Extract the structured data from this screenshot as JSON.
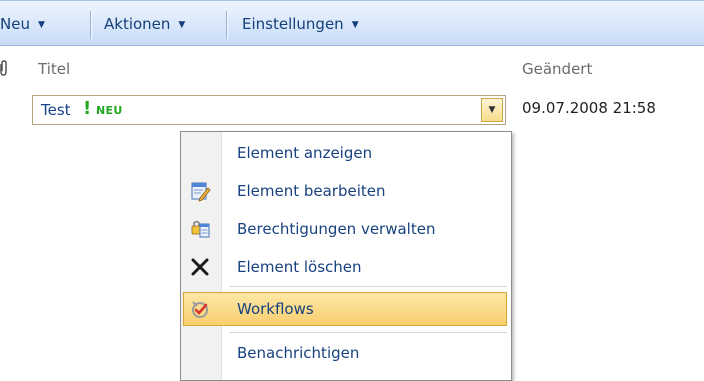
{
  "toolbar": {
    "new_label": "Neu",
    "actions_label": "Aktionen",
    "settings_label": "Einstellungen"
  },
  "list": {
    "columns": {
      "title": "Titel",
      "modified": "Geändert"
    },
    "attachment_icon": "paperclip-icon",
    "rows": [
      {
        "title": "Test",
        "new_mark": "!",
        "new_badge": "NEU",
        "modified": "09.07.2008 21:58"
      }
    ]
  },
  "context_menu": {
    "items": [
      {
        "label": "Element anzeigen",
        "icon": ""
      },
      {
        "label": "Element bearbeiten",
        "icon": "edit-document-icon"
      },
      {
        "label": "Berechtigungen verwalten",
        "icon": "permissions-icon"
      },
      {
        "label": "Element löschen",
        "icon": "delete-x-icon"
      },
      {
        "label": "Workflows",
        "icon": "workflow-icon",
        "highlighted": true
      },
      {
        "label": "Benachrichtigen",
        "icon": ""
      }
    ]
  },
  "colors": {
    "toolbar_text": "#143f7a",
    "new_badge": "#22a81f",
    "highlight": "#f9cf6f",
    "link_text": "#17417f"
  }
}
